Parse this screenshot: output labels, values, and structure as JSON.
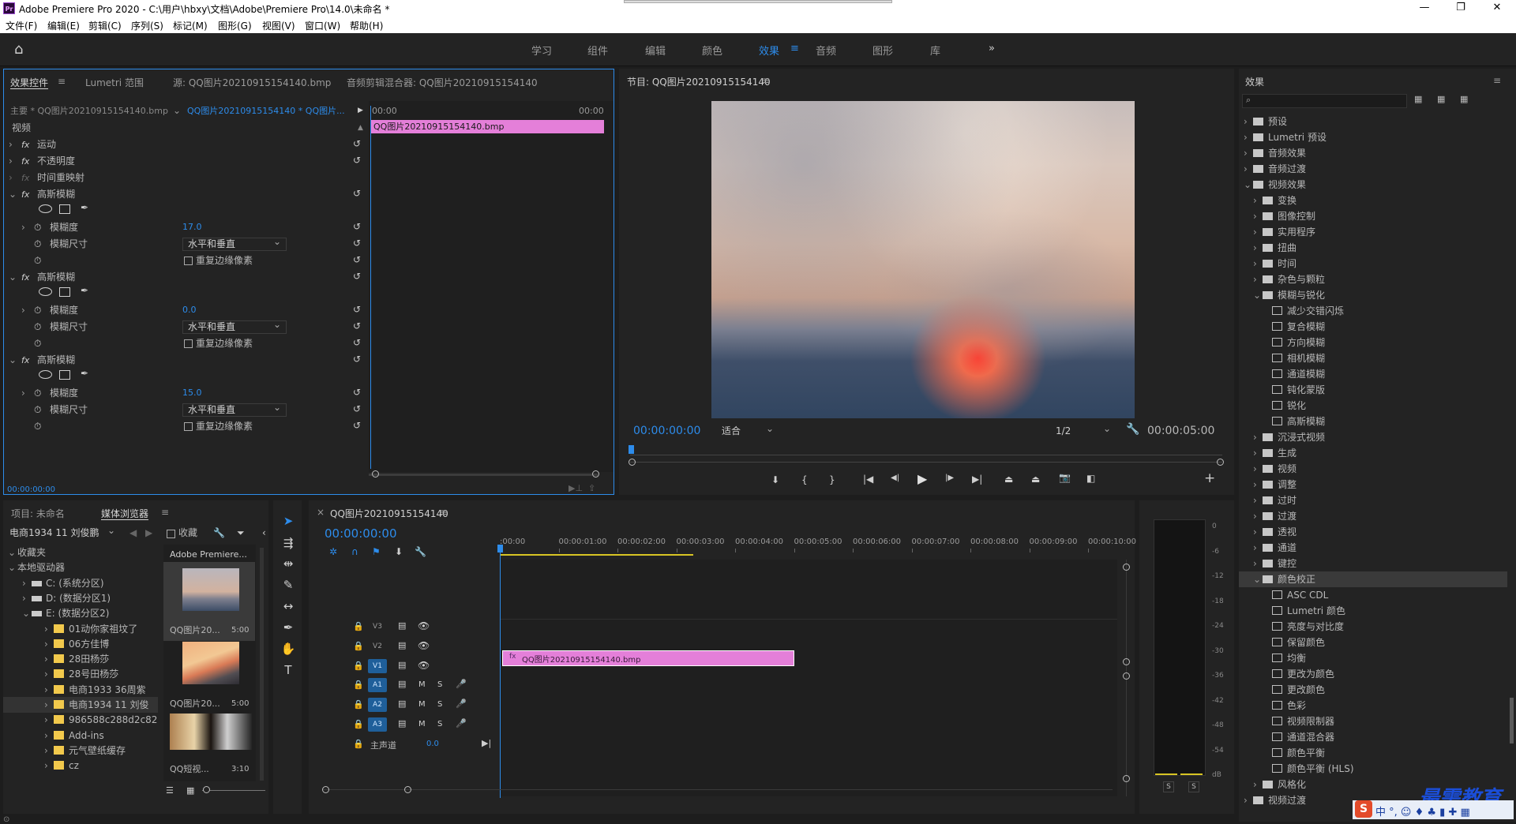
{
  "app": {
    "title": "Adobe Premiere Pro 2020 - C:\\用户\\hbxy\\文档\\Adobe\\Premiere Pro\\14.0\\未命名 *",
    "logo": "Pr"
  },
  "menu": [
    "文件(F)",
    "编辑(E)",
    "剪辑(C)",
    "序列(S)",
    "标记(M)",
    "图形(G)",
    "视图(V)",
    "窗口(W)",
    "帮助(H)"
  ],
  "workspaces": [
    "学习",
    "组件",
    "编辑",
    "颜色",
    "效果",
    "音频",
    "图形",
    "库"
  ],
  "active_workspace": "效果",
  "effect_controls": {
    "tabs": [
      "效果控件",
      "Lumetri 范围",
      "源: QQ图片20210915154140.bmp",
      "音频剪辑混合器: QQ图片20210915154140"
    ],
    "master": "主要 * QQ图片20210915154140.bmp",
    "sequence": "QQ图片20210915154140 * QQ图片...",
    "ruler_start": "00:00",
    "ruler_end": "00:00",
    "clip_name": "QQ图片20210915154140.bmp",
    "video_label": "视频",
    "motion": "运动",
    "opacity": "不透明度",
    "time_remap": "时间重映射",
    "gaussian": "高斯模糊",
    "blurriness": "模糊度",
    "blur_dim": "模糊尺寸",
    "repeat_edge": "重复边缘像素",
    "dim_value": "水平和垂直",
    "blur_values": [
      "17.0",
      "0.0",
      "15.0"
    ],
    "timecode": "00:00:00:00"
  },
  "program": {
    "title": "节目: QQ图片20210915154140",
    "timecode": "00:00:00:00",
    "fit": "适合",
    "quality": "1/2",
    "duration": "00:00:05:00"
  },
  "effects_panel": {
    "title": "效果",
    "items": [
      {
        "label": "预设",
        "level": 0,
        "type": "folder"
      },
      {
        "label": "Lumetri 预设",
        "level": 0,
        "type": "folder"
      },
      {
        "label": "音频效果",
        "level": 0,
        "type": "folder"
      },
      {
        "label": "音频过渡",
        "level": 0,
        "type": "folder"
      },
      {
        "label": "视频效果",
        "level": 0,
        "type": "folder",
        "open": true
      },
      {
        "label": "变换",
        "level": 1,
        "type": "folder"
      },
      {
        "label": "图像控制",
        "level": 1,
        "type": "folder"
      },
      {
        "label": "实用程序",
        "level": 1,
        "type": "folder"
      },
      {
        "label": "扭曲",
        "level": 1,
        "type": "folder"
      },
      {
        "label": "时间",
        "level": 1,
        "type": "folder"
      },
      {
        "label": "杂色与颗粒",
        "level": 1,
        "type": "folder"
      },
      {
        "label": "模糊与锐化",
        "level": 1,
        "type": "folder",
        "open": true
      },
      {
        "label": "减少交错闪烁",
        "level": 2,
        "type": "fx"
      },
      {
        "label": "复合模糊",
        "level": 2,
        "type": "fx"
      },
      {
        "label": "方向模糊",
        "level": 2,
        "type": "fx"
      },
      {
        "label": "相机模糊",
        "level": 2,
        "type": "fx"
      },
      {
        "label": "通道模糊",
        "level": 2,
        "type": "fx"
      },
      {
        "label": "钝化蒙版",
        "level": 2,
        "type": "fx"
      },
      {
        "label": "锐化",
        "level": 2,
        "type": "fx"
      },
      {
        "label": "高斯模糊",
        "level": 2,
        "type": "fx"
      },
      {
        "label": "沉浸式视频",
        "level": 1,
        "type": "folder"
      },
      {
        "label": "生成",
        "level": 1,
        "type": "folder"
      },
      {
        "label": "视频",
        "level": 1,
        "type": "folder"
      },
      {
        "label": "调整",
        "level": 1,
        "type": "folder"
      },
      {
        "label": "过时",
        "level": 1,
        "type": "folder"
      },
      {
        "label": "过渡",
        "level": 1,
        "type": "folder"
      },
      {
        "label": "透视",
        "level": 1,
        "type": "folder"
      },
      {
        "label": "通道",
        "level": 1,
        "type": "folder"
      },
      {
        "label": "键控",
        "level": 1,
        "type": "folder"
      },
      {
        "label": "颜色校正",
        "level": 1,
        "type": "folder",
        "open": true,
        "selected": true
      },
      {
        "label": "ASC CDL",
        "level": 2,
        "type": "fx"
      },
      {
        "label": "Lumetri 颜色",
        "level": 2,
        "type": "fx"
      },
      {
        "label": "亮度与对比度",
        "level": 2,
        "type": "fx"
      },
      {
        "label": "保留颜色",
        "level": 2,
        "type": "fx"
      },
      {
        "label": "均衡",
        "level": 2,
        "type": "fx"
      },
      {
        "label": "更改为颜色",
        "level": 2,
        "type": "fx"
      },
      {
        "label": "更改颜色",
        "level": 2,
        "type": "fx"
      },
      {
        "label": "色彩",
        "level": 2,
        "type": "fx"
      },
      {
        "label": "视频限制器",
        "level": 2,
        "type": "fx"
      },
      {
        "label": "通道混合器",
        "level": 2,
        "type": "fx"
      },
      {
        "label": "颜色平衡",
        "level": 2,
        "type": "fx"
      },
      {
        "label": "颜色平衡 (HLS)",
        "level": 2,
        "type": "fx"
      },
      {
        "label": "风格化",
        "level": 1,
        "type": "folder"
      },
      {
        "label": "视频过渡",
        "level": 0,
        "type": "folder"
      }
    ]
  },
  "project": {
    "tabs": [
      "项目: 未命名",
      "媒体浏览器"
    ],
    "location": "电商1934 11 刘俊鹏",
    "favorites_check": "收藏",
    "tree": [
      {
        "label": "收藏夹",
        "level": 0
      },
      {
        "label": "本地驱动器",
        "level": 0
      },
      {
        "label": "C: (系统分区)",
        "level": 1,
        "drive": true
      },
      {
        "label": "D: (数据分区1)",
        "level": 1,
        "drive": true
      },
      {
        "label": "E: (数据分区2)",
        "level": 1,
        "drive": true
      },
      {
        "label": "01动你家祖坟了",
        "level": 2
      },
      {
        "label": "06方佳博",
        "level": 2
      },
      {
        "label": "28田杨莎",
        "level": 2
      },
      {
        "label": "28号田杨莎",
        "level": 2
      },
      {
        "label": "电商1933 36周紫",
        "level": 2
      },
      {
        "label": "电商1934 11 刘俊",
        "level": 2
      },
      {
        "label": "986588c288d2c829",
        "level": 2
      },
      {
        "label": "Add-ins",
        "level": 2
      },
      {
        "label": "元气壁纸缓存",
        "level": 2
      },
      {
        "label": "cz",
        "level": 2
      }
    ],
    "thumb_header": "Adobe Premiere...",
    "thumbs": [
      {
        "name": "QQ图片20...",
        "dur": "5:00"
      },
      {
        "name": "QQ图片20...",
        "dur": "5:00"
      },
      {
        "name": "QQ短视...",
        "dur": "3:10"
      }
    ]
  },
  "timeline": {
    "title": "QQ图片20210915154140",
    "timecode": "00:00:00:00",
    "ruler": [
      ":00:00",
      "00:00:01:00",
      "00:00:02:00",
      "00:00:03:00",
      "00:00:04:00",
      "00:00:05:00",
      "00:00:06:00",
      "00:00:07:00",
      "00:00:08:00",
      "00:00:09:00",
      "00:00:10:00",
      "0"
    ],
    "tracks": [
      "V3",
      "V2",
      "V1",
      "A1",
      "A2",
      "A3"
    ],
    "master": "主声道",
    "master_value": "0.0",
    "clip": "QQ图片20210915154140.bmp"
  },
  "meter": {
    "labels": [
      "0",
      "-6",
      "-12",
      "-18",
      "-24",
      "-30",
      "-36",
      "-42",
      "-48",
      "-54",
      "dB"
    ],
    "solo": [
      "S",
      "S"
    ]
  },
  "watermark": "最需教育",
  "colors": {
    "accent": "#2d8ceb",
    "clip": "#e47fd9",
    "panel": "#232323",
    "selection_border": "#2d8ceb"
  }
}
